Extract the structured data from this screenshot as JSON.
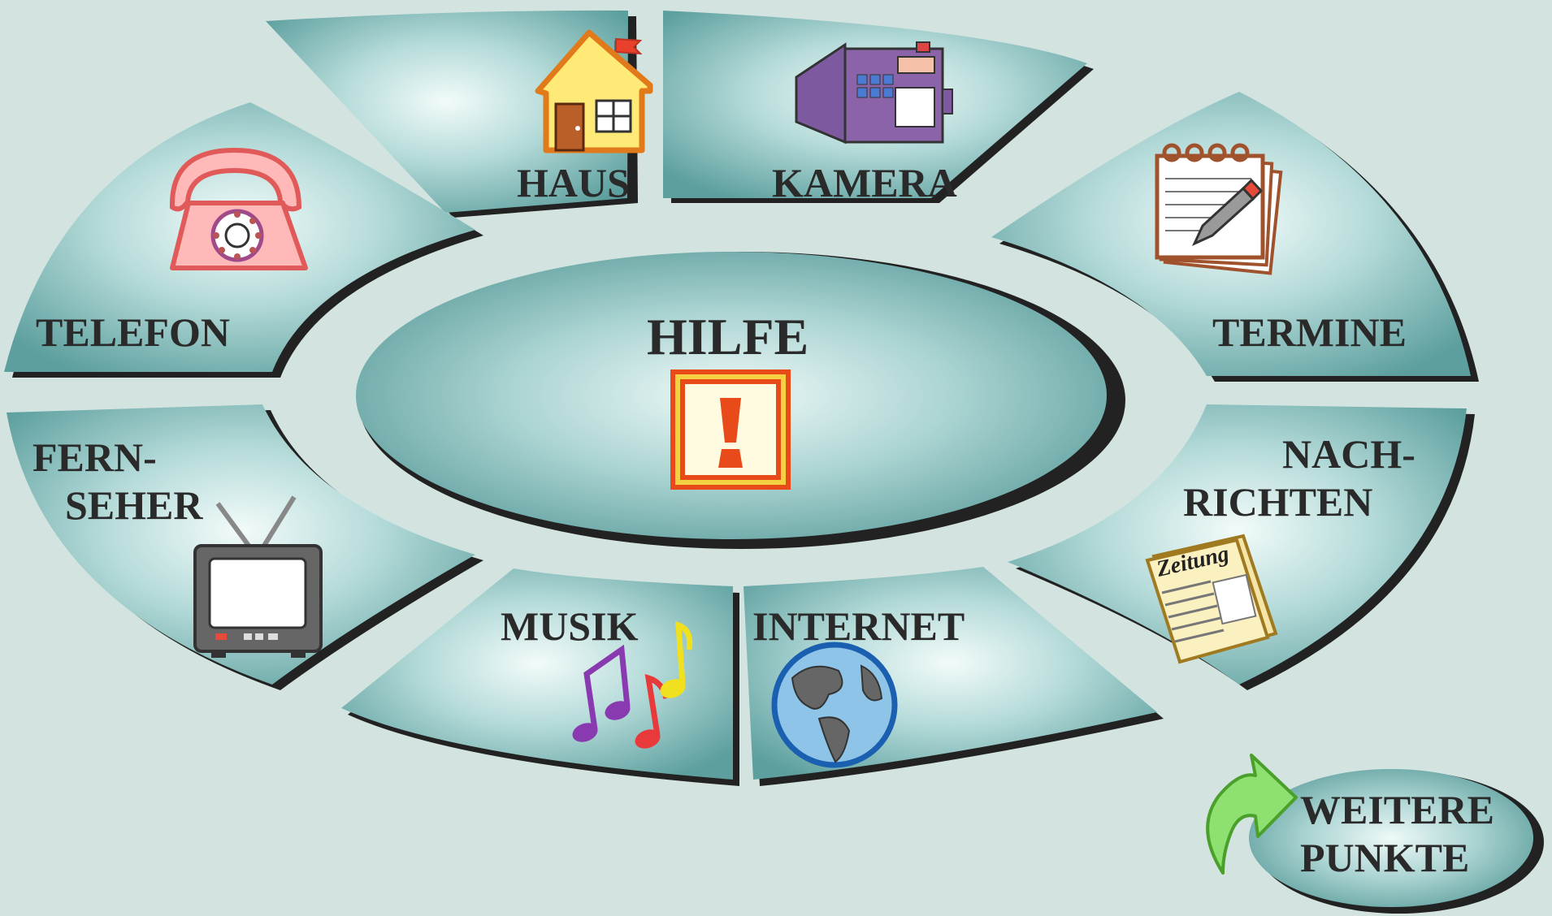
{
  "center": {
    "label": "HILFE",
    "icon": "warning-exclamation-icon"
  },
  "tiles": [
    {
      "id": "haus",
      "label": "HAUS",
      "icon": "house-icon"
    },
    {
      "id": "kamera",
      "label": "KAMERA",
      "icon": "video-camera-icon"
    },
    {
      "id": "telefon",
      "label": "TELEFON",
      "icon": "rotary-phone-icon"
    },
    {
      "id": "termine",
      "label": "TERMINE",
      "icon": "notepad-pencil-icon"
    },
    {
      "id": "fernseher",
      "label_line1": "FERN-",
      "label_line2": "SEHER",
      "icon": "tv-icon"
    },
    {
      "id": "nachrichten",
      "label_line1": "NACH-",
      "label_line2": "RICHTEN",
      "icon": "newspaper-icon",
      "icon_text": "Zeitung"
    },
    {
      "id": "musik",
      "label": "MUSIK",
      "icon": "music-notes-icon"
    },
    {
      "id": "internet",
      "label": "INTERNET",
      "icon": "globe-icon"
    }
  ],
  "more_button": {
    "line1": "WEITERE",
    "line2": "PUNKTE",
    "icon": "green-arrow-icon"
  },
  "colors": {
    "background": "#d3e4e0",
    "tile_light": "#f2fbfa",
    "tile_dark": "#5fa3a2",
    "shadow": "#222222",
    "text": "#2a2a2a"
  }
}
